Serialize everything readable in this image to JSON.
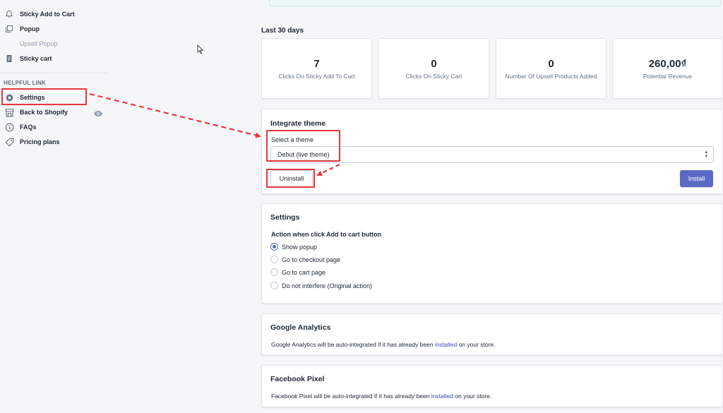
{
  "sidebar": {
    "items": [
      {
        "label": "Sticky Add to Cart",
        "icon": "bell-icon"
      },
      {
        "label": "Popup",
        "icon": "copy-icon"
      },
      {
        "label": "Upsell Popup",
        "icon": ""
      },
      {
        "label": "Sticky cart",
        "icon": "document-icon"
      }
    ],
    "helpful_heading": "HELPFUL LINK",
    "helpful_items": [
      {
        "label": "Settings",
        "icon": "gear-icon"
      },
      {
        "label": "Back to Shopify",
        "icon": "store-icon"
      },
      {
        "label": "FAQs",
        "icon": "info-icon"
      },
      {
        "label": "Pricing plans",
        "icon": "tag-icon"
      }
    ]
  },
  "period_label": "Last 30 days",
  "stats": [
    {
      "value": "7",
      "label": "Clicks On Sticky Add To Cart"
    },
    {
      "value": "0",
      "label": "Clicks On Sticky Cart"
    },
    {
      "value": "0",
      "label": "Number Of Upsell Products Added"
    },
    {
      "value": "260,00₫",
      "label": "Potential Revenue"
    }
  ],
  "integrate": {
    "title": "Integrate theme",
    "select_label": "Select a theme",
    "selected_theme": "Debut (live theme)",
    "uninstall_label": "Uninstall",
    "install_label": "Install"
  },
  "settings": {
    "title": "Settings",
    "subheading": "Action when click Add to cart button",
    "options": [
      {
        "label": "Show popup",
        "checked": true
      },
      {
        "label": "Go to checkout page",
        "checked": false
      },
      {
        "label": "Go to cart page",
        "checked": false
      },
      {
        "label": "Do not interfere (Original action)",
        "checked": false
      }
    ]
  },
  "google_analytics": {
    "title": "Google Analytics",
    "desc_before": "Google Analytics will be auto-integrated if it has already been",
    "link": "installed",
    "desc_after": "on your store."
  },
  "facebook_pixel": {
    "title": "Facebook Pixel",
    "desc_before": "Facebook Pixel will be auto-integrated if it has already been",
    "link": "installed",
    "desc_after": "on your store."
  },
  "colors": {
    "primary": "#5c6ac4",
    "annotation_red": "#e5383b",
    "link": "#3b49c2"
  }
}
